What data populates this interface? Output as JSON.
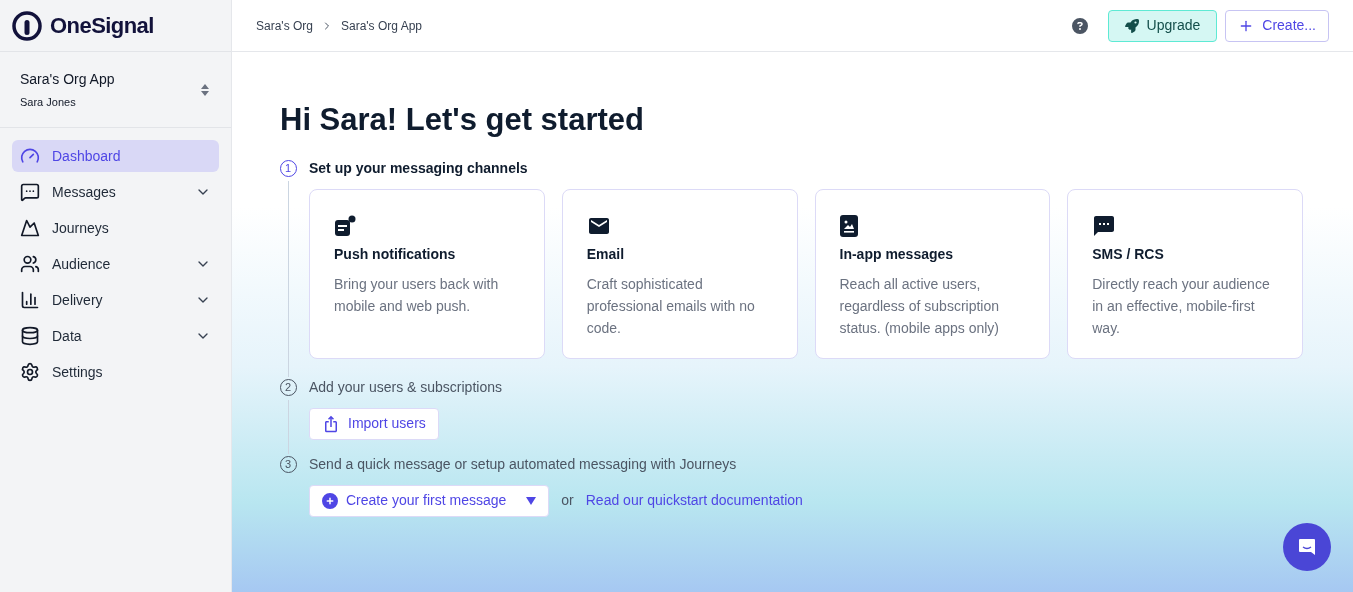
{
  "logo": {
    "text": "OneSignal"
  },
  "app_switcher": {
    "app": "Sara's Org App",
    "user": "Sara Jones"
  },
  "sidebar": {
    "items": [
      {
        "label": "Dashboard",
        "kind": "dashboard",
        "selected": true,
        "expandable": false
      },
      {
        "label": "Messages",
        "kind": "messages",
        "selected": false,
        "expandable": true
      },
      {
        "label": "Journeys",
        "kind": "journeys",
        "selected": false,
        "expandable": false
      },
      {
        "label": "Audience",
        "kind": "audience",
        "selected": false,
        "expandable": true
      },
      {
        "label": "Delivery",
        "kind": "delivery",
        "selected": false,
        "expandable": true
      },
      {
        "label": "Data",
        "kind": "data",
        "selected": false,
        "expandable": true
      },
      {
        "label": "Settings",
        "kind": "settings",
        "selected": false,
        "expandable": false
      }
    ]
  },
  "breadcrumbs": [
    "Sara's Org",
    "Sara's Org App"
  ],
  "header_buttons": {
    "upgrade": "Upgrade",
    "create": "Create..."
  },
  "heading": "Hi Sara! Let's get started",
  "steps": [
    {
      "number": "1",
      "title": "Set up your messaging channels",
      "active": true,
      "kind": "cards"
    },
    {
      "number": "2",
      "title": "Add your users & subscriptions",
      "active": false,
      "kind": "import",
      "button": "Import users"
    },
    {
      "number": "3",
      "title": "Send a quick message or setup automated messaging with Journeys",
      "active": false,
      "kind": "create",
      "button": "Create your first message",
      "or": "or",
      "link": "Read our quickstart documentation"
    }
  ],
  "channels": [
    {
      "kind": "push",
      "title": "Push notifications",
      "text": "Bring your users back with mobile and web push."
    },
    {
      "kind": "email",
      "title": "Email",
      "text": "Craft sophisticated professional emails with no code."
    },
    {
      "kind": "inapp",
      "title": "In-app messages",
      "text": "Reach all active users, regardless of subscription status. (mobile apps only)"
    },
    {
      "kind": "sms",
      "title": "SMS / RCS",
      "text": "Directly reach your audience in an effective, mobile-first way."
    }
  ]
}
